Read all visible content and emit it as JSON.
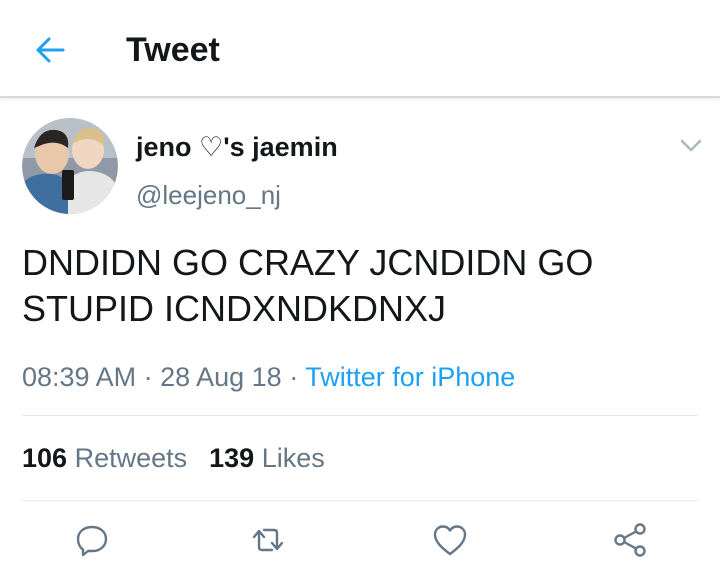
{
  "header": {
    "title": "Tweet",
    "back_icon": "arrow-left-icon"
  },
  "tweet": {
    "display_name": "jeno ♡'s jaemin",
    "handle": "@leejeno_nj",
    "text_line1": "DNDIDN GO CRAZY JCNDIDN GO",
    "text_line2": "STUPID ICNDXNDKDNXJ",
    "time": "08:39 AM",
    "separator1": " · ",
    "date": "28 Aug 18",
    "separator2": " · ",
    "source": "Twitter for iPhone"
  },
  "stats": {
    "retweets_count": "106",
    "retweets_label": " Retweets",
    "likes_count": "139",
    "likes_label": " Likes"
  },
  "actions": [
    "reply-icon",
    "retweet-icon",
    "like-icon",
    "share-icon"
  ],
  "colors": {
    "accent": "#1da1f2",
    "muted": "#657786",
    "text": "#14171a",
    "divider": "#e1e8ed"
  }
}
